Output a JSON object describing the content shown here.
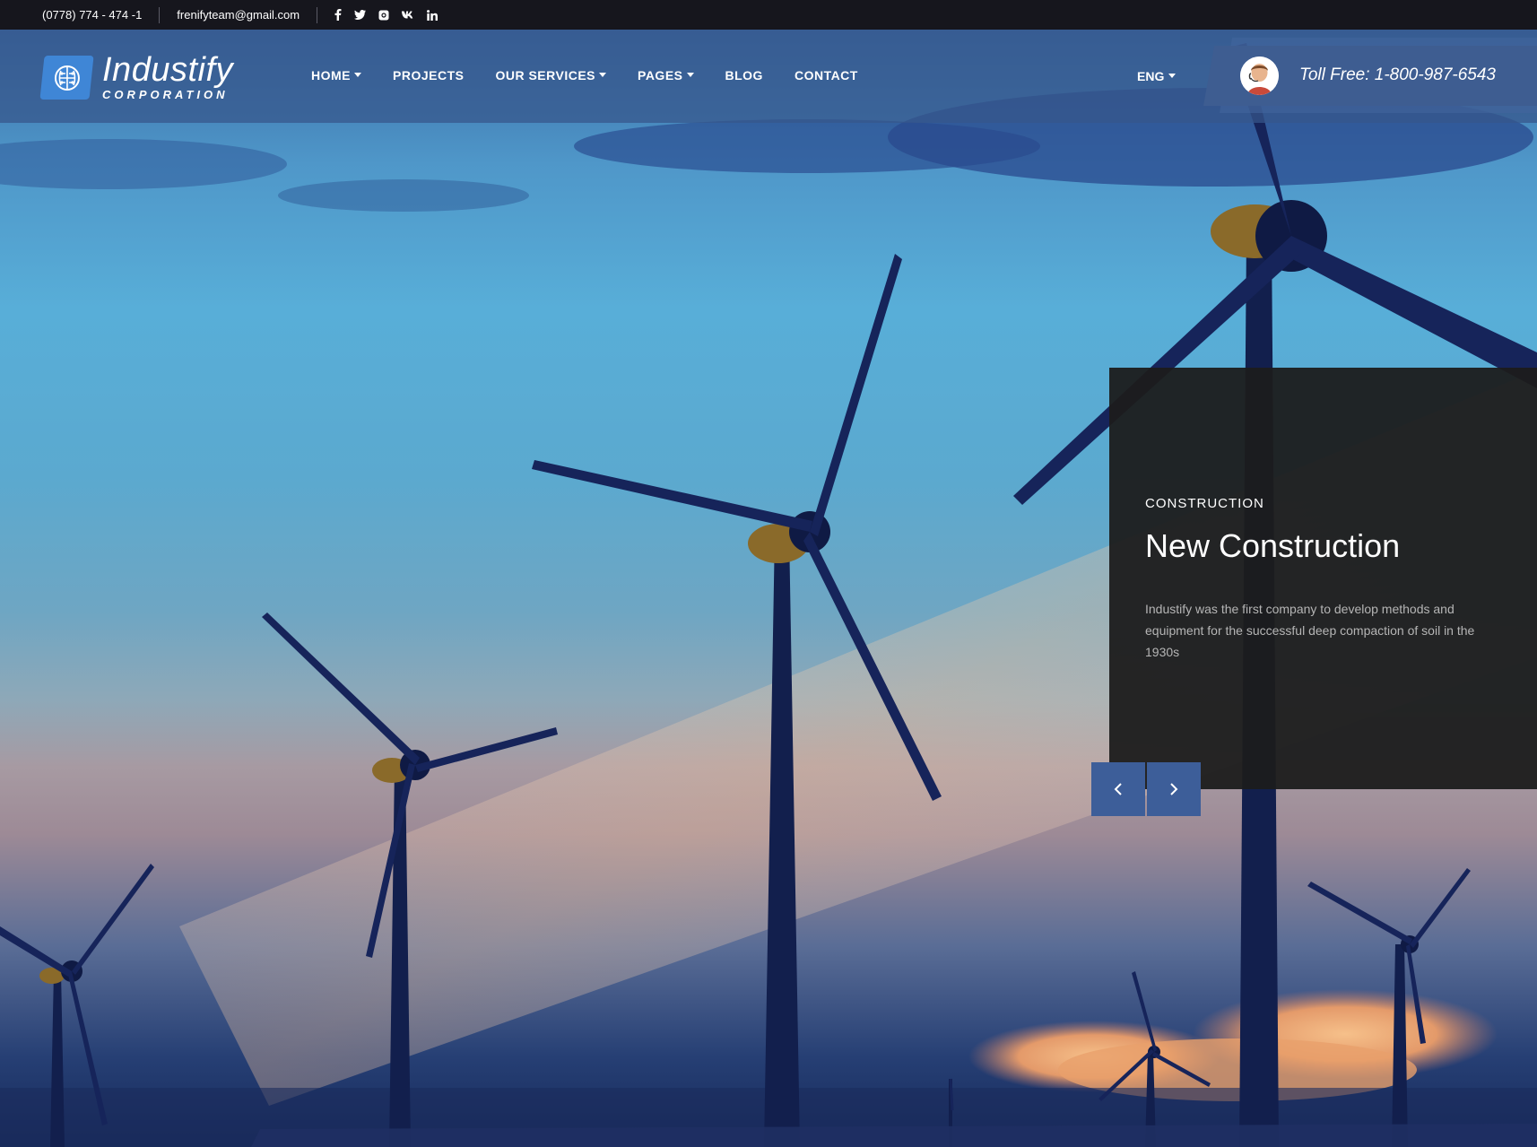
{
  "topbar": {
    "phone": "(0778) 774 - 474 -1",
    "email": "frenifyteam@gmail.com",
    "socials": [
      "facebook-icon",
      "twitter-icon",
      "instagram-icon",
      "vk-icon",
      "linkedin-icon"
    ]
  },
  "logo": {
    "name": "Industify",
    "subtitle": "CORPORATION"
  },
  "nav": {
    "items": [
      {
        "label": "HOME",
        "dropdown": true
      },
      {
        "label": "PROJECTS",
        "dropdown": false
      },
      {
        "label": "OUR SERVICES",
        "dropdown": true
      },
      {
        "label": "PAGES",
        "dropdown": true
      },
      {
        "label": "BLOG",
        "dropdown": false
      },
      {
        "label": "CONTACT",
        "dropdown": false
      }
    ]
  },
  "lang": {
    "label": "ENG"
  },
  "tollfree": {
    "text": "Toll Free: 1-800-987-6543"
  },
  "slide": {
    "category": "CONSTRUCTION",
    "title": "New Construction",
    "text": "Industify was the first company to develop methods and equipment for the successful deep compaction of soil in the 1930s"
  },
  "colors": {
    "topbar": "#16161d",
    "header": "#36568a",
    "accent": "#3e5d91",
    "logo_mark": "#3f86d6",
    "card": "#1c1c1c"
  }
}
